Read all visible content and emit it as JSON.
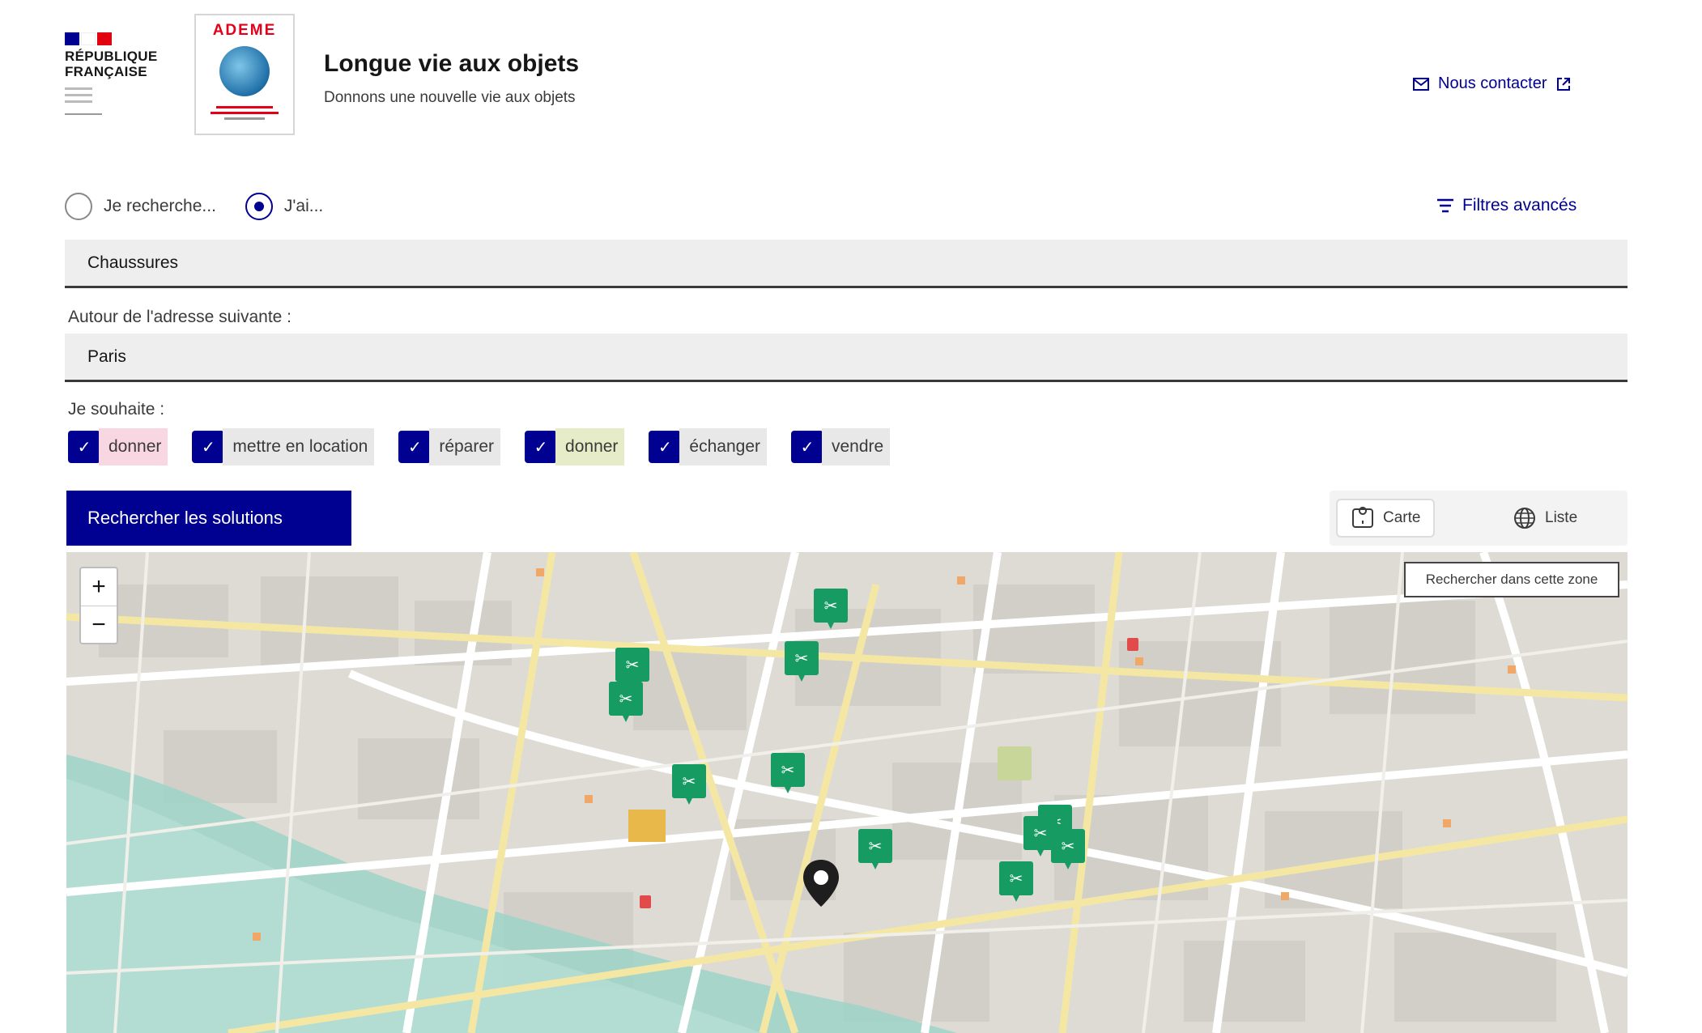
{
  "header": {
    "republic_line1": "RÉPUBLIQUE",
    "republic_line2": "FRANÇAISE",
    "ademe_brand": "ADEME",
    "site_title": "Longue vie aux objets",
    "site_tagline": "Donnons une nouvelle vie aux objets",
    "contact_label": "Nous contacter"
  },
  "search_mode": {
    "options": [
      {
        "label": "Je recherche...",
        "selected": false
      },
      {
        "label": "J'ai...",
        "selected": true
      }
    ],
    "advanced_filters_label": "Filtres avancés"
  },
  "object_field": {
    "value": "Chaussures"
  },
  "address": {
    "label": "Autour de l'adresse suivante :",
    "value": "Paris"
  },
  "wishes": {
    "label": "Je souhaite :",
    "options": [
      {
        "label": "donner",
        "checked": true,
        "color": "#f8d7e3"
      },
      {
        "label": "mettre en location",
        "checked": true,
        "color": "#e8e8e8"
      },
      {
        "label": "réparer",
        "checked": true,
        "color": "#e8e8e8"
      },
      {
        "label": "donner",
        "checked": true,
        "color": "#e6ecc8"
      },
      {
        "label": "échanger",
        "checked": true,
        "color": "#e8e8e8"
      },
      {
        "label": "vendre",
        "checked": true,
        "color": "#e8e8e8"
      }
    ]
  },
  "search_button_label": "Rechercher les solutions",
  "view_switch": {
    "map_label": "Carte",
    "list_label": "Liste"
  },
  "map": {
    "zoom_in": "+",
    "zoom_out": "−",
    "tooltip": "Rechercher dans cette zone",
    "marker_color": "#169b62",
    "marker_icons": [
      "repair-icon"
    ]
  },
  "colors": {
    "primary": "#000091",
    "marker": "#169b62"
  }
}
